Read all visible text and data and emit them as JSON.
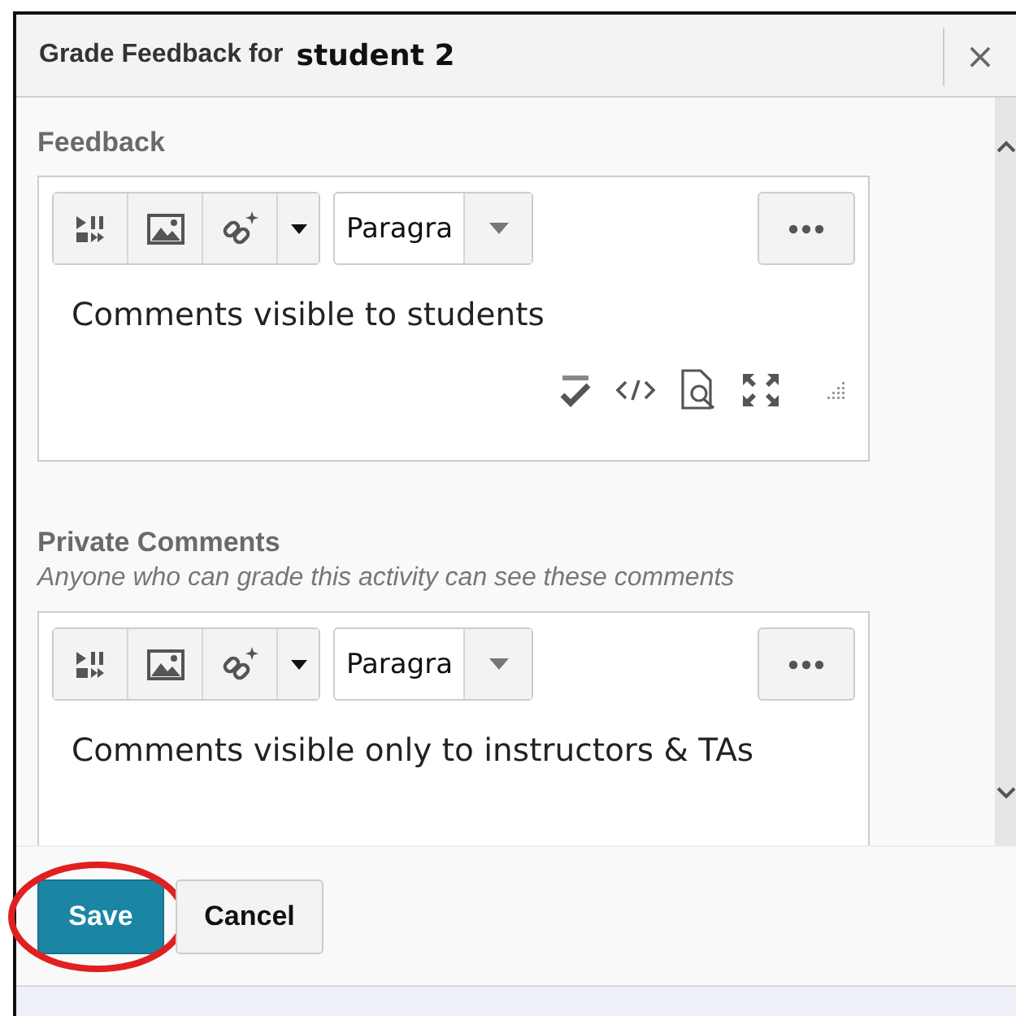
{
  "dialog": {
    "title": "Grade Feedback for",
    "student": "student 2",
    "close": "×"
  },
  "sections": [
    {
      "label": "Feedback",
      "editor": {
        "format": "Paragra",
        "text": "Comments visible to students",
        "status_bar": true
      }
    },
    {
      "label": "Private Comments",
      "note": "Anyone who can grade this activity can see these comments",
      "editor": {
        "format": "Paragra",
        "text": "Comments visible only to instructors & TAs",
        "status_bar": false
      }
    }
  ],
  "buttons": [
    {
      "label": "Save",
      "kind": "primary",
      "highlighted": true
    },
    {
      "label": "Cancel",
      "kind": "secondary",
      "highlighted": false
    }
  ]
}
